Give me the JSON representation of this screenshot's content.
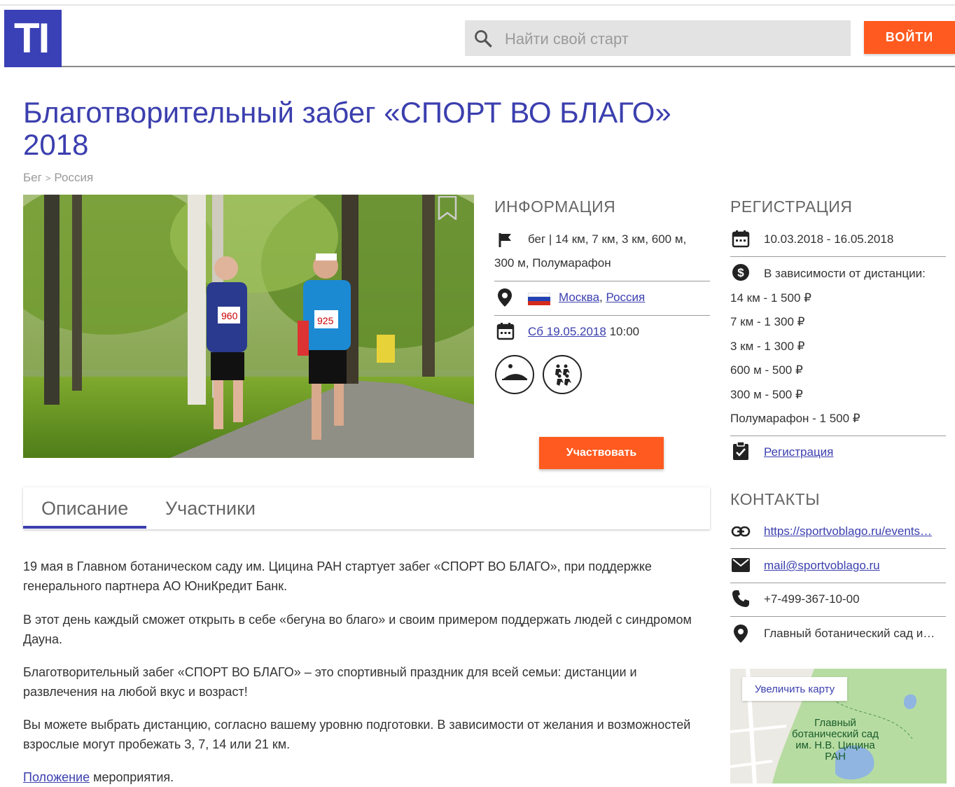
{
  "header": {
    "logo_text": "TI",
    "search_placeholder": "Найти свой старт",
    "login_label": "ВОЙТИ"
  },
  "event": {
    "title": "Благотворительный забег «СПОРТ ВО БЛАГО» 2018",
    "breadcrumb": [
      "Бег",
      ">",
      "Россия"
    ]
  },
  "info": {
    "heading": "ИНФОРМАЦИЯ",
    "distances_line1": "бег | 14 км, 7 км, 3 км, 600 м,",
    "distances_line2": "300 м, Полумарафон",
    "city": "Москва",
    "comma": ",",
    "country": "Россия",
    "date_link": "Сб 19.05.2018",
    "time": "10:00",
    "participate_label": "Участвовать"
  },
  "registration": {
    "heading": "РЕГИСТРАЦИЯ",
    "period": "10.03.2018 - 16.05.2018",
    "price_note": "В зависимости от дистанции:",
    "prices": [
      "14 км - 1 500 ₽",
      "7 км - 1 300 ₽",
      "3 км - 1 300 ₽",
      "600 м - 500 ₽",
      "300 м - 500 ₽",
      "Полумарафон - 1 500 ₽"
    ],
    "link_label": "Регистрация"
  },
  "contacts": {
    "heading": "КОНТАКТЫ",
    "website": "https://sportvoblago.ru/events…",
    "email": "mail@sportvoblago.ru",
    "phone": "+7-499-367-10-00",
    "address": "Главный ботанический сад и…",
    "map_zoom_label": "Увеличить карту",
    "map_place_label": "Главный ботанический сад им. Н.В. Цицина РАН"
  },
  "tabs": [
    {
      "label": "Описание"
    },
    {
      "label": "Участники"
    }
  ],
  "description": {
    "p1": "19 мая в Главном ботаническом саду им. Цицина РАН стартует забег «СПОРТ ВО БЛАГО», при поддержке генерального партнера АО ЮниКредит Банк.",
    "p2": "В этот день каждый сможет открыть в себе «бегуна во благо» и своим примером поддержать людей с синдромом Дауна.",
    "p3": "Благотворительный забег «СПОРТ ВО БЛАГО» – это спортивный праздник для всей семьи: дистанции и развлечения на любой вкус и возраст!",
    "p4": "Вы можете выбрать дистанцию, согласно вашему уровню подготовки. В зависимости от желания и возможностей взрослые могут пробежать 3, 7, 14 или 21 км.",
    "p5_link": "Положение",
    "p5_rest": " мероприятия."
  },
  "photo": {
    "bib_left": "960",
    "bib_right": "925"
  }
}
